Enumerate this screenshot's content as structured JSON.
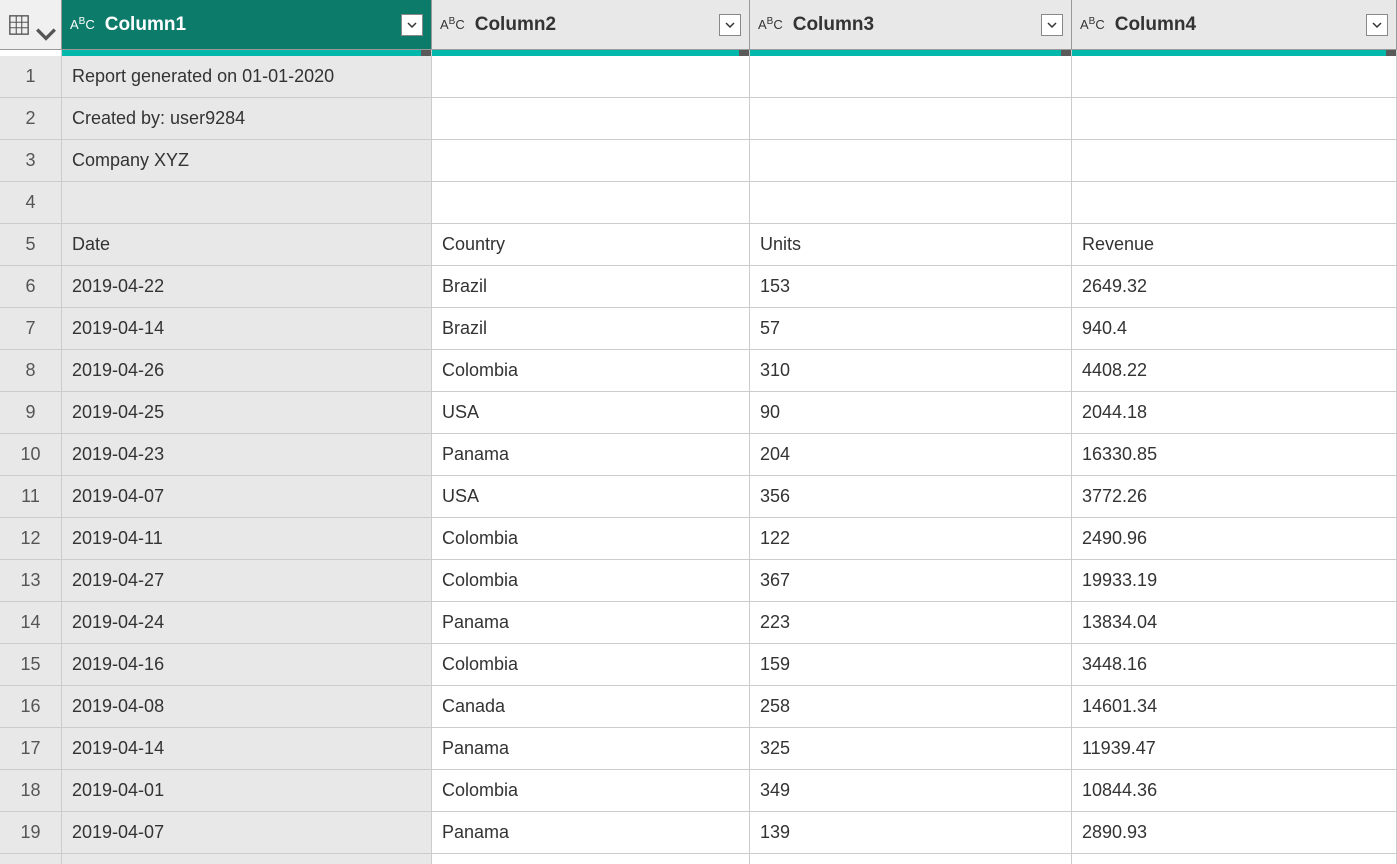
{
  "columns": [
    {
      "name": "Column1",
      "type_label": "ABC",
      "selected": true
    },
    {
      "name": "Column2",
      "type_label": "ABC",
      "selected": false
    },
    {
      "name": "Column3",
      "type_label": "ABC",
      "selected": false
    },
    {
      "name": "Column4",
      "type_label": "ABC",
      "selected": false
    }
  ],
  "rows": [
    {
      "n": "1",
      "c1": "Report generated on 01-01-2020",
      "c2": "",
      "c3": "",
      "c4": ""
    },
    {
      "n": "2",
      "c1": "Created by: user9284",
      "c2": "",
      "c3": "",
      "c4": ""
    },
    {
      "n": "3",
      "c1": "Company XYZ",
      "c2": "",
      "c3": "",
      "c4": ""
    },
    {
      "n": "4",
      "c1": "",
      "c2": "",
      "c3": "",
      "c4": ""
    },
    {
      "n": "5",
      "c1": "Date",
      "c2": "Country",
      "c3": "Units",
      "c4": "Revenue"
    },
    {
      "n": "6",
      "c1": "2019-04-22",
      "c2": "Brazil",
      "c3": "153",
      "c4": "2649.32"
    },
    {
      "n": "7",
      "c1": "2019-04-14",
      "c2": "Brazil",
      "c3": "57",
      "c4": "940.4"
    },
    {
      "n": "8",
      "c1": "2019-04-26",
      "c2": "Colombia",
      "c3": "310",
      "c4": "4408.22"
    },
    {
      "n": "9",
      "c1": "2019-04-25",
      "c2": "USA",
      "c3": "90",
      "c4": "2044.18"
    },
    {
      "n": "10",
      "c1": "2019-04-23",
      "c2": "Panama",
      "c3": "204",
      "c4": "16330.85"
    },
    {
      "n": "11",
      "c1": "2019-04-07",
      "c2": "USA",
      "c3": "356",
      "c4": "3772.26"
    },
    {
      "n": "12",
      "c1": "2019-04-11",
      "c2": "Colombia",
      "c3": "122",
      "c4": "2490.96"
    },
    {
      "n": "13",
      "c1": "2019-04-27",
      "c2": "Colombia",
      "c3": "367",
      "c4": "19933.19"
    },
    {
      "n": "14",
      "c1": "2019-04-24",
      "c2": "Panama",
      "c3": "223",
      "c4": "13834.04"
    },
    {
      "n": "15",
      "c1": "2019-04-16",
      "c2": "Colombia",
      "c3": "159",
      "c4": "3448.16"
    },
    {
      "n": "16",
      "c1": "2019-04-08",
      "c2": "Canada",
      "c3": "258",
      "c4": "14601.34"
    },
    {
      "n": "17",
      "c1": "2019-04-14",
      "c2": "Panama",
      "c3": "325",
      "c4": "11939.47"
    },
    {
      "n": "18",
      "c1": "2019-04-01",
      "c2": "Colombia",
      "c3": "349",
      "c4": "10844.36"
    },
    {
      "n": "19",
      "c1": "2019-04-07",
      "c2": "Panama",
      "c3": "139",
      "c4": "2890.93"
    }
  ]
}
